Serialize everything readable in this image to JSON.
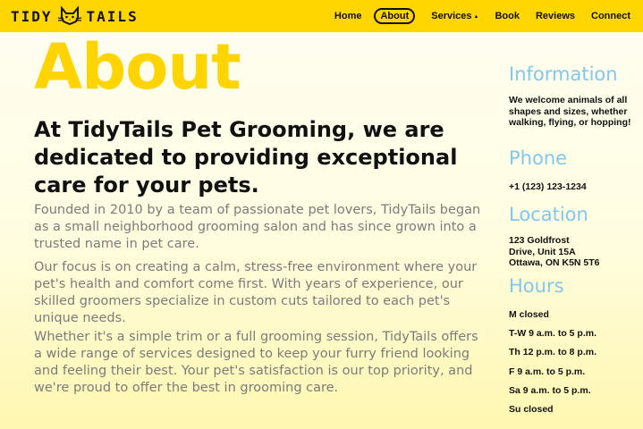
{
  "header": {
    "logo_left": "TIDY",
    "logo_right": "TAILS",
    "logo_icon": "cat-face-icon",
    "nav": [
      {
        "label": "Home",
        "active": false
      },
      {
        "label": "About",
        "active": true
      },
      {
        "label": "Services",
        "active": false,
        "caret": "▲"
      },
      {
        "label": "Book",
        "active": false
      },
      {
        "label": "Reviews",
        "active": false
      },
      {
        "label": "Connect",
        "active": false
      }
    ]
  },
  "main": {
    "title": "About",
    "lead": "At TidyTails Pet Grooming, we are dedicated to providing exceptional care for your pets.",
    "paragraphs": [
      "Founded in 2010 by a team of passionate pet lovers, TidyTails began as a small neighborhood grooming salon and has since grown into a trusted name in pet care.",
      "Our focus is on creating a calm, stress-free environment where your pet's health and comfort come first. With years of experience, our skilled groomers specialize in custom cuts tailored to each pet's unique needs.",
      "Whether it's a simple trim or a full grooming session, TidyTails offers a wide range of services designed to keep your furry friend looking and feeling their best. Your pet's satisfaction is our top priority, and we're proud to offer the best in grooming care."
    ]
  },
  "sidebar": {
    "info_heading": "Information",
    "info_text": "We welcome animals of all shapes and sizes, whether walking, flying, or hopping!",
    "phone_heading": "Phone",
    "phone": "+1 (123) 123-1234",
    "location_heading": "Location",
    "address": [
      "123 Goldfrost",
      "Drive, Unit 15A",
      "Ottawa, ON K5N 5T6"
    ],
    "hours_heading": "Hours",
    "hours": [
      "M closed",
      "T-W 9 a.m. to 5 p.m.",
      "Th 12 p.m. to 8 p.m.",
      "F 9 a.m. to 5 p.m.",
      "Sa 9 a.m. to 5 p.m.",
      "Su closed"
    ]
  },
  "colors": {
    "brand_yellow": "#ffd600",
    "title_yellow": "#ffd400",
    "sidebar_heading_blue": "#7fc8f2",
    "body_gray": "#7b7b7b"
  }
}
